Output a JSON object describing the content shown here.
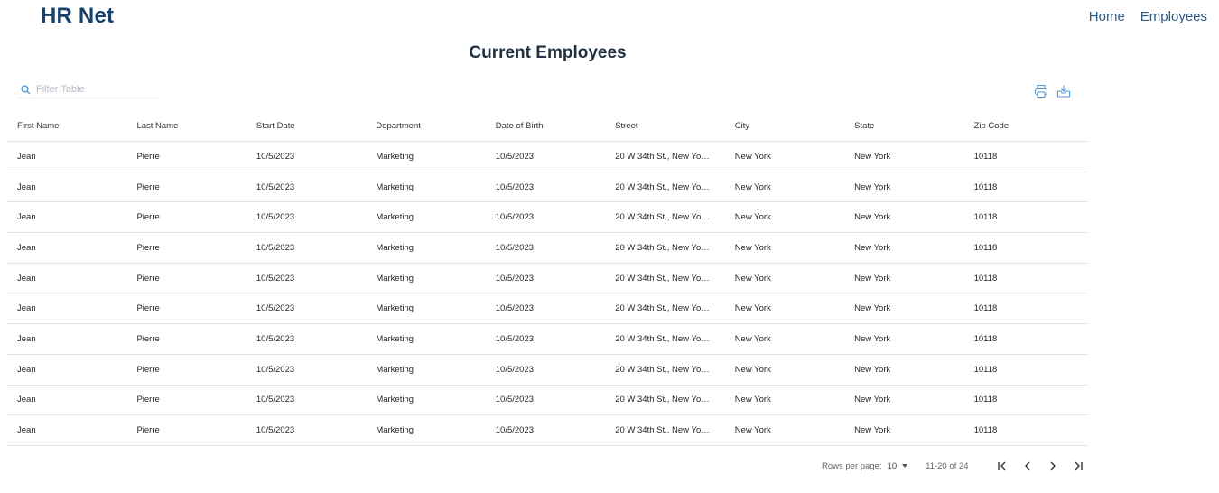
{
  "header": {
    "brand": "HR Net",
    "nav": [
      "Home",
      "Employees"
    ]
  },
  "page": {
    "title": "Current Employees"
  },
  "filter": {
    "placeholder": "Filter Table",
    "icon": "search-icon"
  },
  "toolbar": {
    "icons": [
      "print-icon",
      "download-icon"
    ]
  },
  "table": {
    "columns": [
      "First Name",
      "Last Name",
      "Start Date",
      "Department",
      "Date of Birth",
      "Street",
      "City",
      "State",
      "Zip Code"
    ],
    "rows": [
      [
        "Jean",
        "Pierre",
        "10/5/2023",
        "Marketing",
        "10/5/2023",
        "20 W 34th St., New York, ...",
        "New York",
        "New York",
        "10118"
      ],
      [
        "Jean",
        "Pierre",
        "10/5/2023",
        "Marketing",
        "10/5/2023",
        "20 W 34th St., New York, ...",
        "New York",
        "New York",
        "10118"
      ],
      [
        "Jean",
        "Pierre",
        "10/5/2023",
        "Marketing",
        "10/5/2023",
        "20 W 34th St., New York, ...",
        "New York",
        "New York",
        "10118"
      ],
      [
        "Jean",
        "Pierre",
        "10/5/2023",
        "Marketing",
        "10/5/2023",
        "20 W 34th St., New York, ...",
        "New York",
        "New York",
        "10118"
      ],
      [
        "Jean",
        "Pierre",
        "10/5/2023",
        "Marketing",
        "10/5/2023",
        "20 W 34th St., New York, ...",
        "New York",
        "New York",
        "10118"
      ],
      [
        "Jean",
        "Pierre",
        "10/5/2023",
        "Marketing",
        "10/5/2023",
        "20 W 34th St., New York, ...",
        "New York",
        "New York",
        "10118"
      ],
      [
        "Jean",
        "Pierre",
        "10/5/2023",
        "Marketing",
        "10/5/2023",
        "20 W 34th St., New York, ...",
        "New York",
        "New York",
        "10118"
      ],
      [
        "Jean",
        "Pierre",
        "10/5/2023",
        "Marketing",
        "10/5/2023",
        "20 W 34th St., New York, ...",
        "New York",
        "New York",
        "10118"
      ],
      [
        "Jean",
        "Pierre",
        "10/5/2023",
        "Marketing",
        "10/5/2023",
        "20 W 34th St., New York, ...",
        "New York",
        "New York",
        "10118"
      ],
      [
        "Jean",
        "Pierre",
        "10/5/2023",
        "Marketing",
        "10/5/2023",
        "20 W 34th St., New York, ...",
        "New York",
        "New York",
        "10118"
      ]
    ]
  },
  "pagination": {
    "rows_per_page_label": "Rows per page:",
    "rows_per_page": "10",
    "range": "11-20 of 24",
    "buttons": [
      "first-page-icon",
      "previous-page-icon",
      "next-page-icon",
      "last-page-icon"
    ]
  },
  "colors": {
    "brand": "#17406b",
    "nav": "#2f5a84",
    "icon": "#5b9bd5"
  }
}
